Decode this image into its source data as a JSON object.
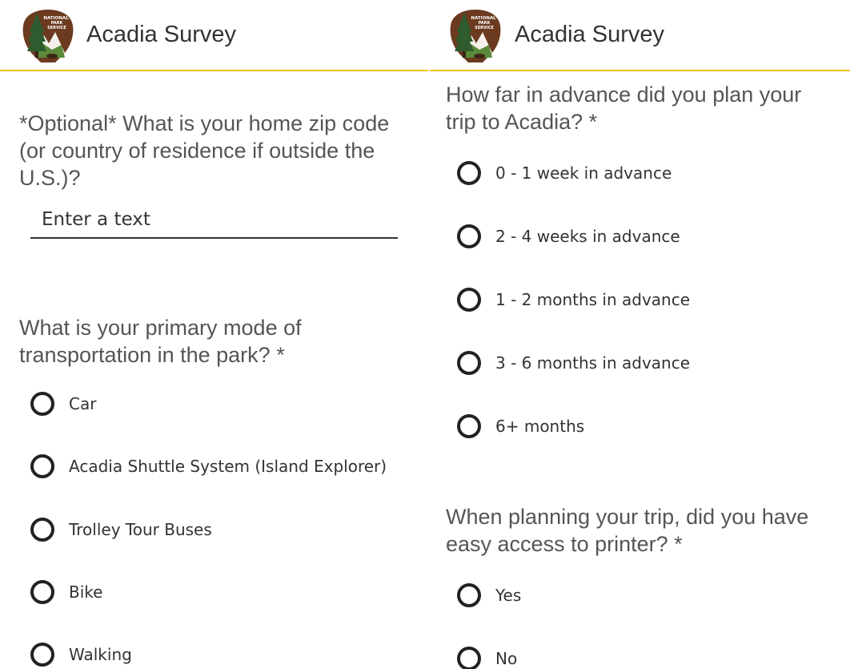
{
  "left_pane": {
    "app_title": "Acadia Survey",
    "logo_text": "NATIONAL PARK SERVICE",
    "zip_question": "*Optional* What is your home zip code (or country of residence if outside the U.S.)?",
    "zip_input": {
      "placeholder": "Enter a text",
      "value": ""
    },
    "transport_question": "What is your primary mode of transportation in the park? *",
    "transport_options": [
      "Car",
      "Acadia Shuttle System (Island Explorer)",
      "Trolley Tour Buses",
      "Bike",
      "Walking"
    ]
  },
  "right_pane": {
    "app_title": "Acadia Survey",
    "logo_text": "NATIONAL PARK SERVICE",
    "advance_question": "How far in advance did you plan your trip to Acadia? *",
    "advance_options": [
      "0 - 1 week in advance",
      "2 - 4 weeks in advance",
      "1 - 2 months in advance",
      "3 - 6 months in advance",
      "6+ months"
    ],
    "printer_question": "When planning your trip, did you have easy access to printer? *",
    "printer_options": [
      "Yes",
      "No"
    ]
  },
  "colors": {
    "header_rule": "#f2c21b",
    "logo_brown": "#6b3a1f",
    "logo_green": "#2e5c2e"
  },
  "icons": {
    "logo": "nps-arrowhead-logo",
    "radio": "radio-unselected-icon"
  }
}
